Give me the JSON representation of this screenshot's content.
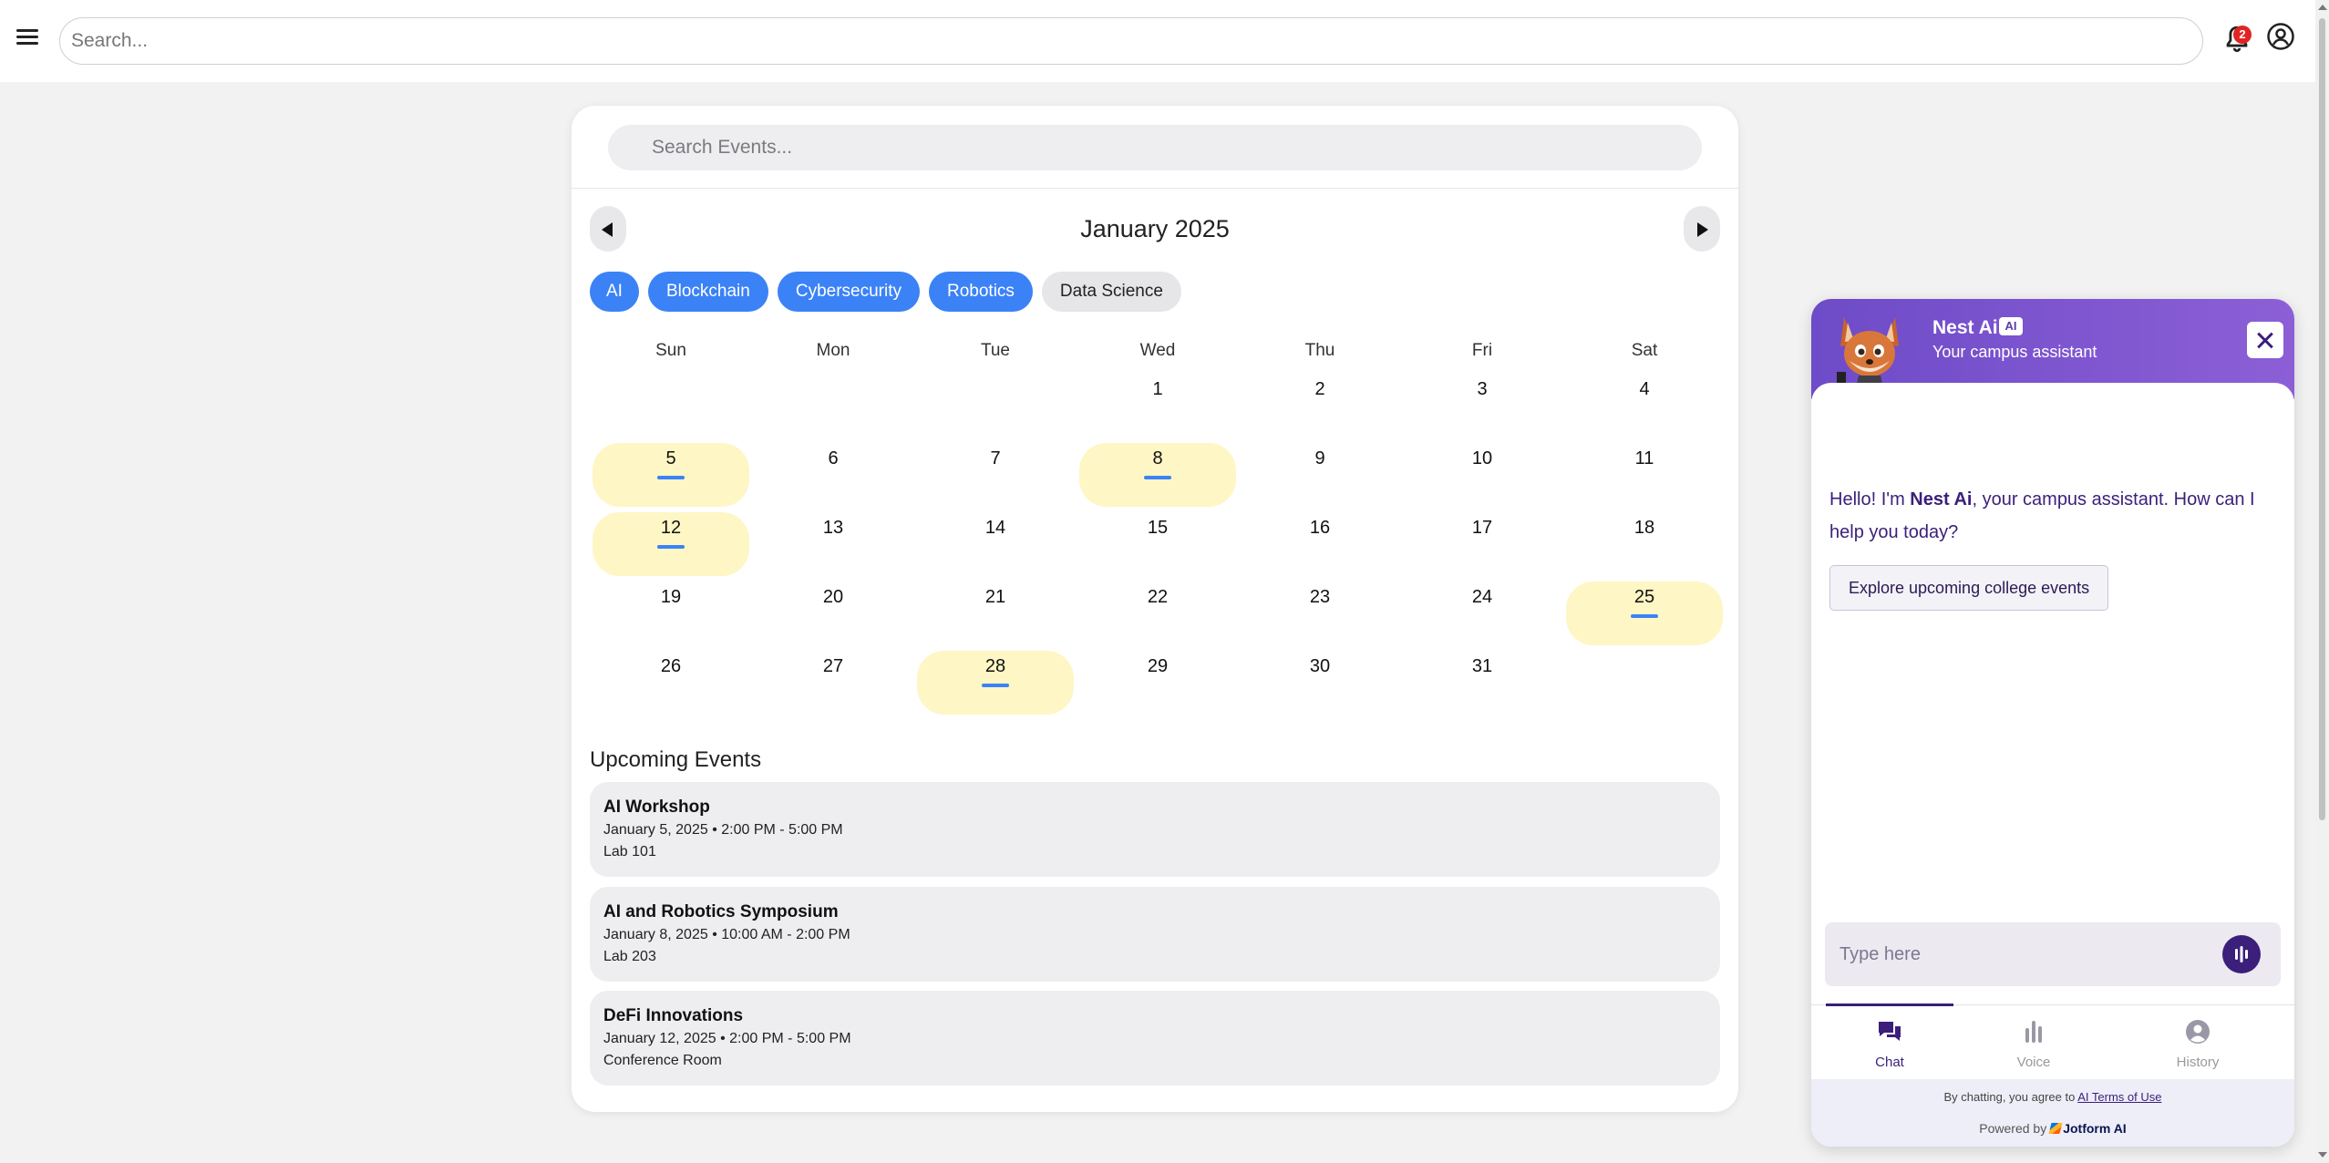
{
  "topbar": {
    "search_placeholder": "Search...",
    "notification_count": "2"
  },
  "calendar": {
    "search_placeholder": "Search Events...",
    "month_title": "January 2025",
    "tags": [
      {
        "label": "AI",
        "active": true
      },
      {
        "label": "Blockchain",
        "active": true
      },
      {
        "label": "Cybersecurity",
        "active": true
      },
      {
        "label": "Robotics",
        "active": true
      },
      {
        "label": "Data Science",
        "active": false
      }
    ],
    "weekdays": [
      "Sun",
      "Mon",
      "Tue",
      "Wed",
      "Thu",
      "Fri",
      "Sat"
    ],
    "first_weekday_index": 3,
    "days_in_month": 31,
    "event_days": [
      5,
      8,
      12,
      25,
      28
    ],
    "highlight_color": "#fef6c4",
    "marker_color": "#3b82f6"
  },
  "upcoming": {
    "title": "Upcoming Events",
    "events": [
      {
        "name": "AI Workshop",
        "time": "January 5, 2025 • 2:00 PM - 5:00 PM",
        "location": "Lab 101"
      },
      {
        "name": "AI and Robotics Symposium",
        "time": "January 8, 2025 • 10:00 AM - 2:00 PM",
        "location": "Lab 203"
      },
      {
        "name": "DeFi Innovations",
        "time": "January 12, 2025 • 2:00 PM - 5:00 PM",
        "location": "Conference Room"
      }
    ]
  },
  "chat": {
    "bot_name": "Nest Ai",
    "ai_badge": "AI",
    "subtitle": "Your campus assistant",
    "greeting_pre": "Hello! I'm ",
    "greeting_name": "Nest Ai",
    "greeting_post": ", your campus assistant. How can I help you today?",
    "suggestion": "Explore upcoming college events",
    "input_placeholder": "Type here",
    "tabs": [
      {
        "label": "Chat",
        "icon": "chat-icon",
        "active": true
      },
      {
        "label": "Voice",
        "icon": "voice-bars-icon",
        "active": false
      },
      {
        "label": "History",
        "icon": "history-icon",
        "active": false
      }
    ],
    "terms_pre": "By chatting, you agree to ",
    "terms_link": "AI Terms of Use",
    "powered_pre": "Powered by",
    "powered_brand": "Jotform AI",
    "accent_color": "#7c54d0"
  }
}
